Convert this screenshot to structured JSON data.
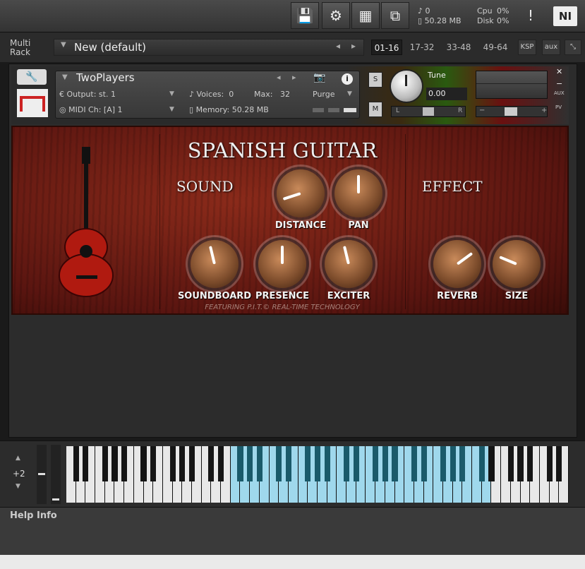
{
  "toolbar": {
    "voices": "0",
    "memory": "50.28 MB",
    "cpu_label": "Cpu",
    "cpu_val": "0%",
    "disk_label": "Disk",
    "disk_val": "0%",
    "warn": "!",
    "logo": "NI"
  },
  "rack": {
    "label_line1": "Multi",
    "label_line2": "Rack",
    "preset": "New (default)",
    "ranges": [
      "01-16",
      "17-32",
      "33-48",
      "49-64"
    ],
    "ksp": "KSP",
    "aux": "aux"
  },
  "instrument": {
    "name": "TwoPlayers",
    "output_label": "Output:",
    "output_val": "st. 1",
    "voices_label": "Voices:",
    "voices_val": "0",
    "max_label": "Max:",
    "max_val": "32",
    "purge": "Purge",
    "midi_label": "MIDI Ch:",
    "midi_val": "[A]  1",
    "memory_label": "Memory:",
    "memory_val": "50.28 MB",
    "solo": "S",
    "mute": "M",
    "tune_label": "Tune",
    "tune_val": "0.00",
    "pan_l": "L",
    "pan_r": "R",
    "aux": "AUX",
    "pv": "PV"
  },
  "panel": {
    "title": "SPANISH GUITAR",
    "sound": "SOUND",
    "effect": "EFFECT",
    "footer": "FEATURING P.I.T.© REAL-TIME TECHNOLOGY",
    "knobs": [
      {
        "label": "DISTANCE",
        "value": 0.1
      },
      {
        "label": "PAN",
        "value": 0.5
      },
      {
        "label": "SOUNDBOARD",
        "value": 0.45
      },
      {
        "label": "PRESENCE",
        "value": 0.5
      },
      {
        "label": "EXCITER",
        "value": 0.45
      },
      {
        "label": "REVERB",
        "value": 0.7
      },
      {
        "label": "SIZE",
        "value": 0.25
      }
    ]
  },
  "keyboard": {
    "octave": "+2"
  },
  "help": {
    "label": "Help Info"
  }
}
